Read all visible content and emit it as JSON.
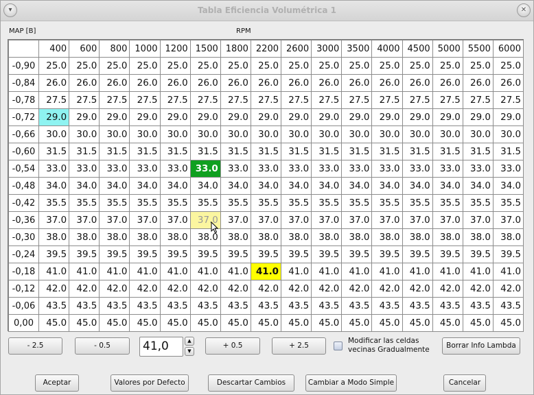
{
  "window": {
    "title": "Tabla Eficiencia Volumétrica 1"
  },
  "labels": {
    "map": "MAP [B]",
    "rpm": "RPM"
  },
  "columns": [
    "400",
    "600",
    "800",
    "1000",
    "1200",
    "1500",
    "1800",
    "2200",
    "2600",
    "3000",
    "3500",
    "4000",
    "4500",
    "5000",
    "5500",
    "6000"
  ],
  "rows": [
    {
      "map": "-0,90",
      "value": "25.0"
    },
    {
      "map": "-0,84",
      "value": "26.0"
    },
    {
      "map": "-0,78",
      "value": "27.5"
    },
    {
      "map": "-0,72",
      "value": "29.0"
    },
    {
      "map": "-0,66",
      "value": "30.0"
    },
    {
      "map": "-0,60",
      "value": "31.5"
    },
    {
      "map": "-0,54",
      "value": "33.0"
    },
    {
      "map": "-0,48",
      "value": "34.0"
    },
    {
      "map": "-0,42",
      "value": "35.5"
    },
    {
      "map": "-0,36",
      "value": "37.0"
    },
    {
      "map": "-0,30",
      "value": "38.0"
    },
    {
      "map": "-0,24",
      "value": "39.5"
    },
    {
      "map": "-0,18",
      "value": "41.0"
    },
    {
      "map": "-0,12",
      "value": "42.0"
    },
    {
      "map": "-0,06",
      "value": "43.5"
    },
    {
      "map": "0,00",
      "value": "45.0"
    }
  ],
  "highlights": [
    {
      "row": 3,
      "col": 0,
      "style": "c-cyan"
    },
    {
      "row": 6,
      "col": 5,
      "style": "c-green"
    },
    {
      "row": 12,
      "col": 7,
      "style": "c-yellow"
    },
    {
      "row": 9,
      "col": 5,
      "style": "c-hover"
    }
  ],
  "controls": {
    "minus_2_5": "- 2.5",
    "minus_0_5": "- 0.5",
    "spin_value": "41,0",
    "plus_0_5": "+ 0.5",
    "plus_2_5": "+ 2.5",
    "checkbox_label": "Modificar las celdas vecinas Gradualmente",
    "clear_lambda": "Borrar Info Lambda"
  },
  "footer": {
    "accept": "Aceptar",
    "defaults": "Valores por Defecto",
    "discard": "Descartar Cambios",
    "simple_mode": "Cambiar a Modo Simple",
    "cancel": "Cancelar"
  }
}
